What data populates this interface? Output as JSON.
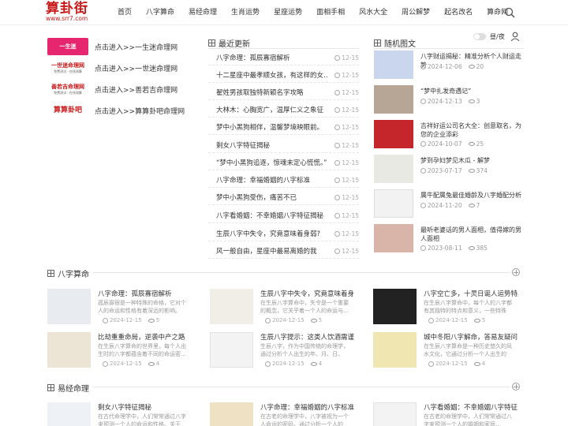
{
  "site": {
    "logo_main": "算卦街",
    "logo_sub": "www.srr7.com"
  },
  "nav": [
    "首页",
    "八字算命",
    "易经命理",
    "生肖运势",
    "星座运势",
    "面相手相",
    "风水大全",
    "周公解梦",
    "起名改名",
    "算命网"
  ],
  "theme": {
    "accent": "#c81a1a",
    "toggle_label": "昼/夜"
  },
  "partner_links": [
    {
      "banner": "一生迷",
      "banner_sub": "",
      "text": "点击进入>>一生迷命理网",
      "bg": "#e6266e",
      "fg": "#ffffff"
    },
    {
      "banner": "一世迷命理网",
      "banner_sub": "免费测试 · 在线测算",
      "text": "点击进入>>一世迷命理网",
      "bg": "#ffffff",
      "fg": "#c81a1a"
    },
    {
      "banner": "善若吉命理网",
      "banner_sub": "免费测试 · 在线测算",
      "text": "点击进入>>善若吉命理网",
      "bg": "#ffffff",
      "fg": "#c81a1a"
    },
    {
      "banner": "算算卦吧",
      "banner_sub": "",
      "text": "点击进入>>算算卦吧命理网",
      "bg": "#ffffff",
      "fg": "#c81a1a"
    }
  ],
  "latest": {
    "title": "最近更新",
    "items": [
      {
        "title": "八字命理：孤辰寡宿解析",
        "date": "12-15"
      },
      {
        "title": "十二星座中最孝顺女孩，有这样的女…",
        "date": "12-15"
      },
      {
        "title": "翟姓男孩取独特新颖名字攻略",
        "date": "12-15"
      },
      {
        "title": "大林木：心胸宽广，温厚仁义之象征",
        "date": "12-15"
      },
      {
        "title": "梦中小黑狗相伴，温馨梦境映眼前。",
        "date": "12-15"
      },
      {
        "title": "剩女八字特征揭秘",
        "date": "12-15"
      },
      {
        "title": "“梦中小黑狗追逐，惊魂未定心慌慌。”",
        "date": "12-15"
      },
      {
        "title": "八字命理：幸福婚姻的八字标准",
        "date": "12-15"
      },
      {
        "title": "梦中小黑狗受伤，痛苦不已",
        "date": "12-15"
      },
      {
        "title": "八字看婚姻：不幸婚姻八字特征揭秘",
        "date": "12-15"
      },
      {
        "title": "生辰八字中失令，究竟意味着身弱?",
        "date": "12-15"
      },
      {
        "title": "风一般自由，星座中最易离婚的我",
        "date": "12-15"
      }
    ]
  },
  "random": {
    "title": "随机图文",
    "items": [
      {
        "title": "八字财运揭秘：精准分析个人财运走势",
        "date": "2024-12-06",
        "views": "20",
        "bg": "#c9d6ee"
      },
      {
        "title": "“梦中扎发奇遇记”",
        "date": "2024-12-13",
        "views": "3",
        "bg": "#b7a596"
      },
      {
        "title": "吉祥好运公司名大全：创意取名，为您的企业添彩",
        "date": "2024-10-07",
        "views": "25",
        "bg": "#c4262c"
      },
      {
        "title": "梦到孕妇梦见木瓜 - 解梦",
        "date": "2023-07-17",
        "views": "374",
        "bg": "#e9e9e4"
      },
      {
        "title": "属牛配属兔最佳婚龄及八字婚配分析",
        "date": "2024-11-20",
        "views": "7",
        "bg": "#f2f2f2"
      },
      {
        "title": "最听老婆话的男人面相，值得嫁的男人面相",
        "date": "2023-08-11",
        "views": "385",
        "bg": "#d9b5a9"
      }
    ]
  },
  "bazi": {
    "title": "八字算命",
    "cards": [
      {
        "title": "八字命理：孤辰寡宿解析",
        "excerpt": "孤辰寡宿是一种特殊的命格，它对个人的命运和性格有着深远的影响。",
        "date": "2024-12-15",
        "views": "5",
        "bg": "#e8ecf1"
      },
      {
        "title": "生辰八字中失令，究竟意味着身…",
        "excerpt": "在生辰八字算命中，失令是一个重要的概念，它关乎着一个人的命运与…",
        "date": "2024-12-15",
        "views": "5",
        "bg": "#f0eee6"
      },
      {
        "title": "八字空亡多，十灵日诞人运势特异",
        "excerpt": "在生辰八字算命中，每个人的八字都有其独特的特点和意义，一些特殊",
        "date": "2024-12-15",
        "views": "5",
        "bg": "#222222"
      },
      {
        "title": "比劫重重命局，逆袭中产之路",
        "excerpt": "在生辰八字算命的世界里，每个人出生时的八字都蕴含着不同的命运密…",
        "date": "2024-12-15",
        "views": "4",
        "bg": "#ece5d5"
      },
      {
        "title": "生辰八字提示：这类人饮酒需谨…",
        "excerpt": "生辰八字，作为中国传统的命理学，通过分析个人出生的年、月、日、",
        "date": "2024-12-15",
        "views": "4",
        "bg": "#f3f3f3"
      },
      {
        "title": "城中冬阳八字解命，答易友疑问…",
        "excerpt": "在生辰八字算命是一种历史悠久的风水文化，它通过分析一个人出生的年、",
        "date": "2024-12-15",
        "views": "4",
        "bg": "#efe6b2"
      }
    ]
  },
  "yijing": {
    "title": "易经命理",
    "cards": [
      {
        "title": "剩女八字特征揭秘",
        "excerpt": "在古代命理学中，人们常常通过八字来预测一个人的命运和性格。关于",
        "bg": "#eef1f6"
      },
      {
        "title": "八字命理：幸福婚姻的八字标准",
        "excerpt": "在古老的命理学中，八字被视为一个人命运的密码，通过分析一个人的",
        "bg": "#efe2c4"
      },
      {
        "title": "八字看婚姻：不幸婚姻八字特征…",
        "excerpt": "在古老的命理学中，人们常常通过八字来预测一个人的婚姻和家庭…",
        "bg": "#f3f3f3"
      }
    ]
  }
}
